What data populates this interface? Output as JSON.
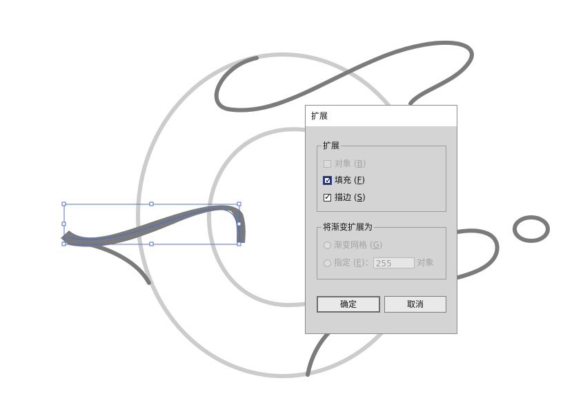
{
  "dialog": {
    "title": "扩展",
    "expand_group": {
      "label": "扩展",
      "object": {
        "text": "对象",
        "key": "B",
        "checked": false,
        "enabled": false
      },
      "fill": {
        "text": "填充",
        "key": "F",
        "checked": true,
        "enabled": true
      },
      "stroke": {
        "text": "描边",
        "key": "S",
        "checked": true,
        "enabled": true
      }
    },
    "gradient_group": {
      "label": "将渐变扩展为",
      "mesh": {
        "text": "渐变网格",
        "key": "G",
        "enabled": false
      },
      "specify": {
        "text": "指定",
        "key": "E",
        "value": "255",
        "unit": "对象",
        "enabled": false
      }
    },
    "ok_label": "确定",
    "cancel_label": "取消"
  },
  "colors": {
    "light_stroke": "#cccccc",
    "dark_stroke": "#7b7b7b",
    "selection": "#4a6fd1",
    "dialog_bg": "#d4d4d4"
  }
}
